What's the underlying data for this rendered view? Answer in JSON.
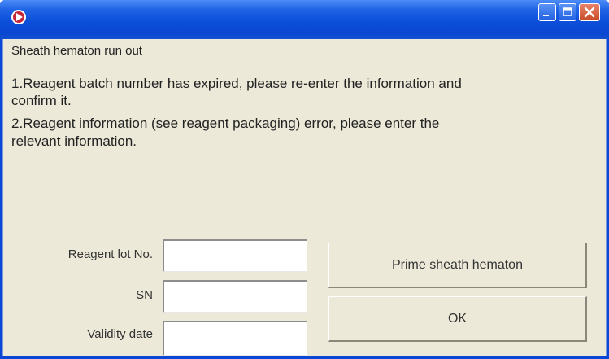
{
  "window": {
    "title": "",
    "icons": {
      "app": "app-icon",
      "minimize": "minimize-icon",
      "maximize": "maximize-icon",
      "close": "close-icon"
    },
    "colors": {
      "titlebar": "#0a47d6",
      "client_background": "#ece9d8",
      "close_button": "#d0542f"
    }
  },
  "status": {
    "text": "Sheath hematon run out"
  },
  "message": {
    "lines": [
      "1.Reagent batch number has expired, please re-enter the information and",
      "confirm it.",
      "2.Reagent information (see reagent packaging) error, please enter the",
      "relevant information."
    ]
  },
  "form": {
    "lot_label": "Reagent lot No.",
    "lot_value": "",
    "sn_label": "SN",
    "sn_value": "",
    "validity_label": "Validity date",
    "validity_value": ""
  },
  "buttons": {
    "prime_label": "Prime sheath hematon",
    "ok_label": "OK"
  }
}
